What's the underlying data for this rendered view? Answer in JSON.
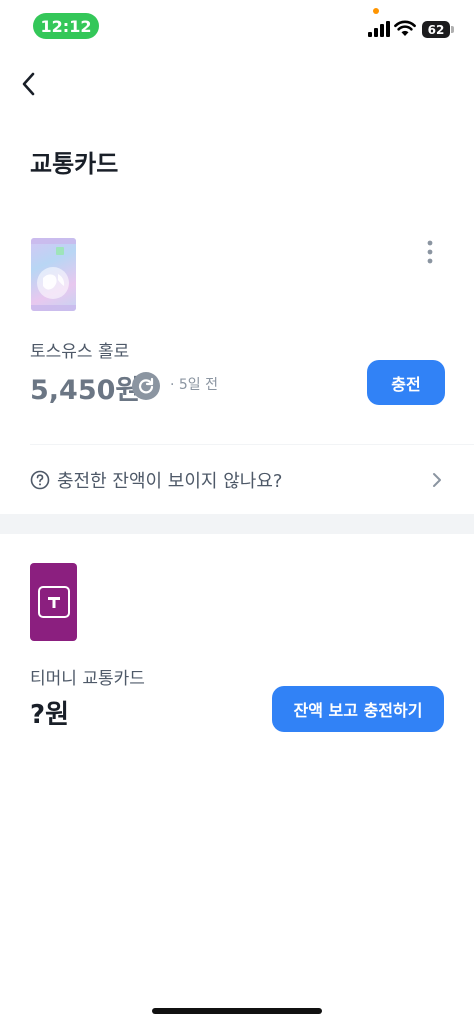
{
  "status_bar": {
    "time": "12:12",
    "battery": "62"
  },
  "header": {
    "title": "교통카드"
  },
  "cards": [
    {
      "name": "토스유스 홀로",
      "balance": "5,450원",
      "updated": "· 5일 전",
      "button_label": "충전"
    },
    {
      "name": "티머니 교통카드",
      "balance": "?원",
      "button_label": "잔액 보고 충전하기"
    }
  ],
  "help": {
    "text": "충전한 잔액이 보이지 않나요?"
  },
  "colors": {
    "accent": "#3182f6",
    "tmoney": "#8b1f7f",
    "status_green": "#34c759"
  }
}
